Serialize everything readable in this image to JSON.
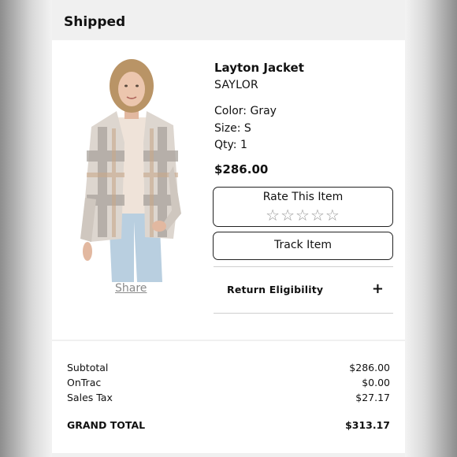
{
  "header": {
    "title": "Shipped"
  },
  "item": {
    "name": "Layton Jacket",
    "brand": "SAYLOR",
    "color": "Color: Gray",
    "size": "Size: S",
    "qty": "Qty: 1",
    "price": "$286.00",
    "share_label": "Share",
    "image_icon": "product-photo"
  },
  "actions": {
    "rate_label": "Rate This Item",
    "stars": "☆☆☆☆☆",
    "rating_value": 0,
    "rating_max": 5,
    "track_label": "Track Item",
    "return_label": "Return Eligibility",
    "expand_icon": "+"
  },
  "summary": {
    "subtotal_label": "Subtotal",
    "subtotal": "$286.00",
    "shipping_label": "OnTrac",
    "shipping": "$0.00",
    "tax_label": "Sales Tax",
    "tax": "$27.17",
    "grand_label": "GRAND TOTAL",
    "grand": "$313.17"
  },
  "colors": {
    "border": "#222222",
    "muted": "#8a8a8a",
    "background": "#f0f0f0"
  }
}
